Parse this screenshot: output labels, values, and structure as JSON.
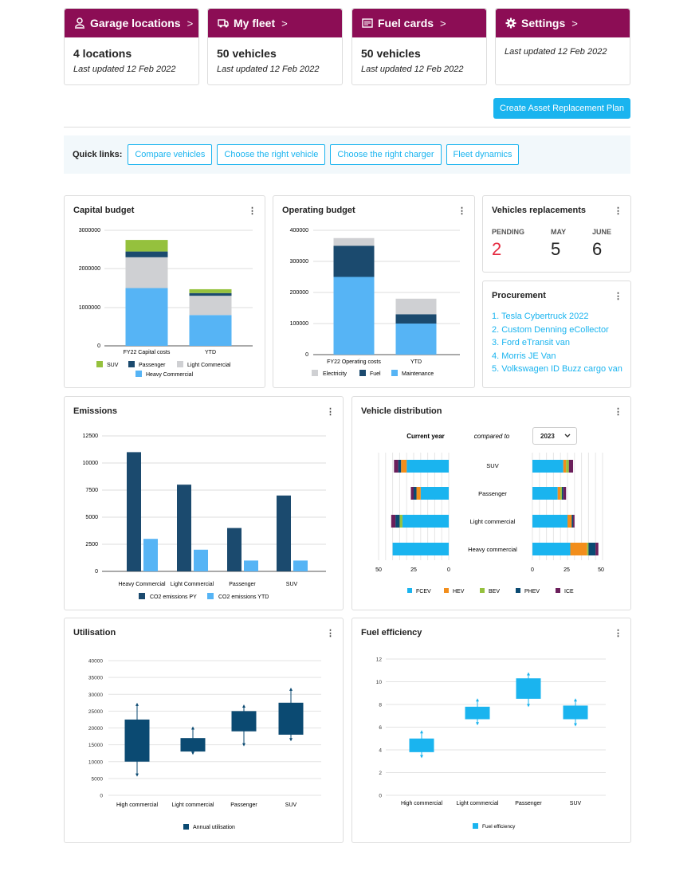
{
  "tiles": [
    {
      "title": "Garage locations",
      "icon": "location-person-icon",
      "value": "4 locations",
      "sub": "Last updated 12 Feb 2022"
    },
    {
      "title": "My fleet",
      "icon": "truck-icon",
      "value": "50 vehicles",
      "sub": "Last updated 12 Feb 2022"
    },
    {
      "title": "Fuel cards",
      "icon": "card-icon",
      "value": "50 vehicles",
      "sub": "Last updated 12 Feb 2022"
    },
    {
      "title": "Settings",
      "icon": "gear-icon",
      "value": "",
      "sub": "Last updated 12 Feb 2022"
    }
  ],
  "chevron": ">",
  "create_plan_label": "Create Asset Replacement Plan",
  "quick_links": {
    "label": "Quick links:",
    "items": [
      "Compare vehicles",
      "Choose the right vehicle",
      "Choose the right charger",
      "Fleet dynamics"
    ]
  },
  "colors": {
    "brand": "#8c0d55",
    "accent": "#1ab4ef",
    "dark_blue": "#1b4a6e",
    "light_blue": "#56b4f5",
    "grey": "#cfd0d3",
    "green": "#95c13d",
    "orange": "#f28e1c",
    "purple": "#6b1f5b",
    "navy": "#0b4a72",
    "pending_red": "#e5293f"
  },
  "cards": {
    "capital": {
      "title": "Capital budget"
    },
    "operating": {
      "title": "Operating budget"
    },
    "replacements": {
      "title": "Vehicles replacements",
      "items": [
        {
          "label": "PENDING",
          "value": "2"
        },
        {
          "label": "MAY",
          "value": "5"
        },
        {
          "label": "JUNE",
          "value": "6"
        }
      ]
    },
    "procurement": {
      "title": "Procurement",
      "items": [
        "1. Tesla Cybertruck 2022",
        "2. Custom Denning eCollector",
        "3. Ford eTransit van",
        "4. Morris JE Van",
        "5. Volkswagen ID Buzz cargo van"
      ]
    },
    "emissions": {
      "title": "Emissions"
    },
    "distribution": {
      "title": "Vehicle distribution",
      "current_label": "Current year",
      "compared_label": "compared to",
      "year": "2023"
    },
    "utilisation": {
      "title": "Utilisation"
    },
    "fuel": {
      "title": "Fuel efficiency"
    },
    "kebab": "⋮"
  },
  "chart_data": [
    {
      "id": "capital",
      "type": "bar",
      "stacked": true,
      "categories": [
        "FY22 Capital costs",
        "YTD"
      ],
      "series": [
        {
          "name": "Heavy Commercial",
          "values": [
            1500000,
            800000
          ]
        },
        {
          "name": "Light Commercial",
          "values": [
            800000,
            500000
          ]
        },
        {
          "name": "Passenger",
          "values": [
            150000,
            70000
          ]
        },
        {
          "name": "SUV",
          "values": [
            300000,
            100000
          ]
        }
      ],
      "yticks": [
        "0",
        "1000000",
        "2000000",
        "3000000"
      ],
      "ylim": [
        0,
        3000000
      ],
      "legend": [
        "SUV",
        "Passenger",
        "Light Commercial",
        "Heavy Commercial"
      ]
    },
    {
      "id": "operating",
      "type": "bar",
      "stacked": true,
      "categories": [
        "FY22 Operating costs",
        "YTD"
      ],
      "series": [
        {
          "name": "Maintenance",
          "values": [
            250000,
            100000
          ]
        },
        {
          "name": "Fuel",
          "values": [
            100000,
            30000
          ]
        },
        {
          "name": "Electricity",
          "values": [
            25000,
            50000
          ]
        }
      ],
      "yticks": [
        "0",
        "100000",
        "200000",
        "300000",
        "400000"
      ],
      "ylim": [
        0,
        400000
      ],
      "legend": [
        "Electricity",
        "Fuel",
        "Maintenance"
      ]
    },
    {
      "id": "emissions",
      "type": "bar",
      "categories": [
        "Heavy Commercial",
        "Light Commercial",
        "Passenger",
        "SUV"
      ],
      "series": [
        {
          "name": "CO2 emissions PY",
          "values": [
            11000,
            8000,
            4000,
            7000
          ]
        },
        {
          "name": "CO2 emissions YTD",
          "values": [
            3000,
            2000,
            1000,
            1000
          ]
        }
      ],
      "yticks": [
        "0",
        "2500",
        "5000",
        "7500",
        "10000",
        "12500"
      ],
      "ylim": [
        0,
        12500
      ]
    },
    {
      "id": "distribution",
      "type": "bar",
      "orientation": "horizontal",
      "stacked": true,
      "categories": [
        "SUV",
        "Passenger",
        "Light commercial",
        "Heavy commercial"
      ],
      "current": [
        {
          "name": "FCEV",
          "values": [
            30,
            20,
            33,
            40
          ]
        },
        {
          "name": "HEV",
          "values": [
            4,
            3,
            0,
            0
          ]
        },
        {
          "name": "BEV",
          "values": [
            0,
            0,
            2,
            0
          ]
        },
        {
          "name": "PHEV",
          "values": [
            2,
            2,
            3,
            0
          ]
        },
        {
          "name": "ICE",
          "values": [
            3,
            2,
            3,
            0
          ]
        }
      ],
      "compared": [
        {
          "name": "FCEV",
          "values": [
            22,
            18,
            25,
            27
          ]
        },
        {
          "name": "HEV",
          "values": [
            2,
            2,
            3,
            12
          ]
        },
        {
          "name": "BEV",
          "values": [
            2,
            1,
            0,
            1
          ]
        },
        {
          "name": "PHEV",
          "values": [
            0,
            1,
            1,
            5
          ]
        },
        {
          "name": "ICE",
          "values": [
            3,
            2,
            1,
            2
          ]
        }
      ],
      "xticks_left": [
        "50",
        "25",
        "0"
      ],
      "xticks_right": [
        "0",
        "25",
        "50"
      ],
      "xlim": [
        0,
        50
      ],
      "legend": [
        "FCEV",
        "HEV",
        "BEV",
        "PHEV",
        "ICE"
      ]
    },
    {
      "id": "utilisation",
      "type": "boxplot",
      "categories": [
        "High commercial",
        "Light commercial",
        "Passenger",
        "SUV"
      ],
      "series": [
        {
          "name": "Annual utilisation",
          "boxes": [
            {
              "min": 6000,
              "q1": 10000,
              "q3": 22500,
              "max": 27000
            },
            {
              "min": 12500,
              "q1": 13000,
              "q3": 17000,
              "max": 20000
            },
            {
              "min": 15000,
              "q1": 19000,
              "q3": 25000,
              "max": 26500
            },
            {
              "min": 16500,
              "q1": 18000,
              "q3": 27500,
              "max": 31500
            }
          ]
        }
      ],
      "yticks": [
        "0",
        "5000",
        "10000",
        "15000",
        "20000",
        "25000",
        "30000",
        "35000",
        "40000"
      ],
      "ylim": [
        0,
        40000
      ]
    },
    {
      "id": "fuel",
      "type": "boxplot",
      "categories": [
        "High commercial",
        "Light commercial",
        "Passenger",
        "SUV"
      ],
      "series": [
        {
          "name": "Fuel efficiency",
          "boxes": [
            {
              "min": 3.4,
              "q1": 3.8,
              "q3": 5,
              "max": 5.6
            },
            {
              "min": 6.3,
              "q1": 6.7,
              "q3": 7.8,
              "max": 8.4
            },
            {
              "min": 7.9,
              "q1": 8.5,
              "q3": 10.3,
              "max": 10.7
            },
            {
              "min": 6.2,
              "q1": 6.7,
              "q3": 7.9,
              "max": 8.4
            }
          ]
        }
      ],
      "yticks": [
        "0",
        "2",
        "4",
        "6",
        "8",
        "10",
        "12"
      ],
      "ylim": [
        0,
        12
      ]
    }
  ]
}
